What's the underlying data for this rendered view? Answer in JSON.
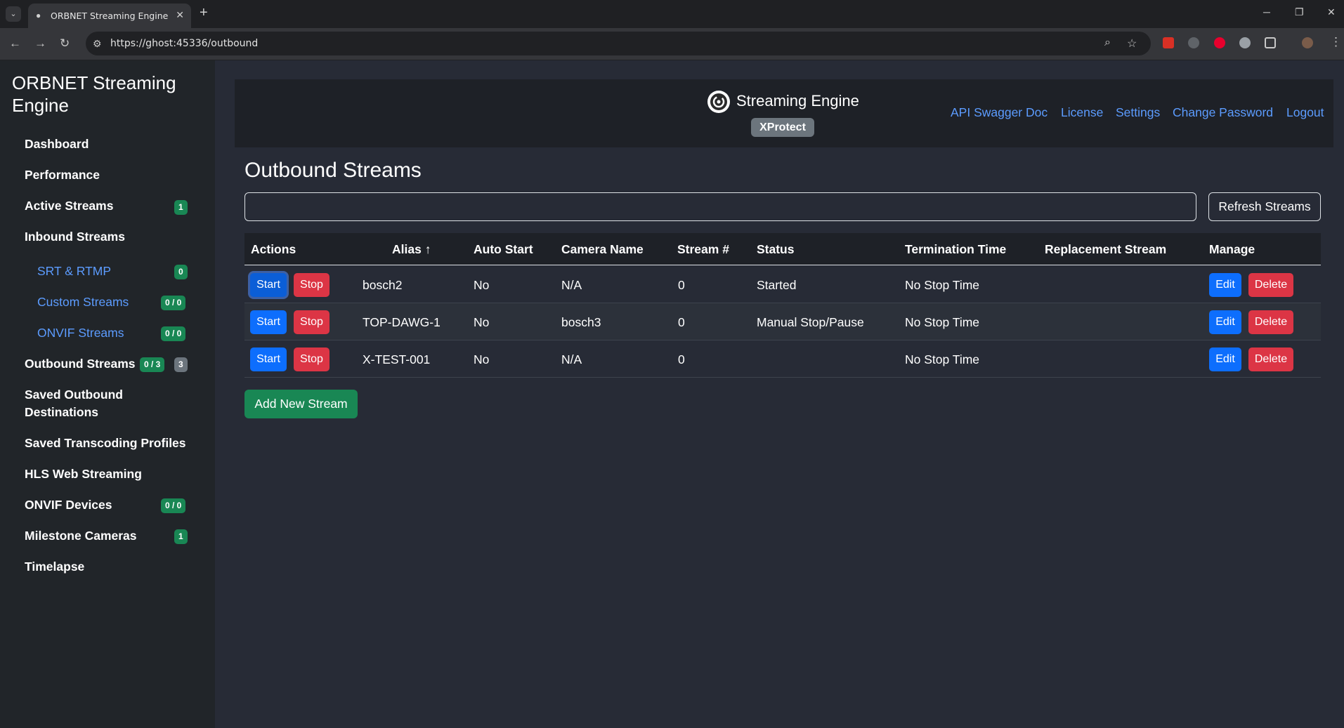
{
  "browser": {
    "tab_title": "ORBNET Streaming Engine",
    "url": "https://ghost:45336/outbound"
  },
  "sidebar": {
    "brand": "ORBNET Streaming Engine",
    "items": [
      {
        "label": "Dashboard"
      },
      {
        "label": "Performance"
      },
      {
        "label": "Active Streams",
        "badge": "1"
      },
      {
        "label": "Inbound Streams"
      },
      {
        "label": "SRT & RTMP",
        "badge": "0"
      },
      {
        "label": "Custom Streams",
        "badge": "0 / 0"
      },
      {
        "label": "ONVIF Streams",
        "badge": "0 / 0"
      },
      {
        "label": "Outbound Streams",
        "badge": "0 / 3",
        "badge2": "3"
      },
      {
        "label": "Saved Outbound Destinations"
      },
      {
        "label": "Saved Transcoding Profiles"
      },
      {
        "label": "HLS Web Streaming"
      },
      {
        "label": "ONVIF Devices",
        "badge": "0 / 0"
      },
      {
        "label": "Milestone Cameras",
        "badge": "1"
      },
      {
        "label": "Timelapse"
      }
    ]
  },
  "header": {
    "app_title": "Streaming Engine",
    "edition": "XProtect",
    "links": [
      "API Swagger Doc",
      "License",
      "Settings",
      "Change Password",
      "Logout"
    ]
  },
  "main": {
    "title": "Outbound Streams",
    "filter_value": "",
    "refresh_label": "Refresh Streams",
    "add_label": "Add New Stream",
    "columns": [
      "Actions",
      "Alias ↑",
      "Auto Start",
      "Camera Name",
      "Stream #",
      "Status",
      "Termination Time",
      "Replacement Stream",
      "Manage"
    ],
    "buttons": {
      "start": "Start",
      "stop": "Stop",
      "edit": "Edit",
      "delete": "Delete"
    },
    "rows": [
      {
        "alias": "bosch2",
        "auto_start": "No",
        "camera": "N/A",
        "stream": "0",
        "status": "Started",
        "termination": "No Stop Time",
        "replacement": ""
      },
      {
        "alias": "TOP-DAWG-1",
        "auto_start": "No",
        "camera": "bosch3",
        "stream": "0",
        "status": "Manual Stop/Pause",
        "termination": "No Stop Time",
        "replacement": ""
      },
      {
        "alias": "X-TEST-001",
        "auto_start": "No",
        "camera": "N/A",
        "stream": "0",
        "status": "",
        "termination": "No Stop Time",
        "replacement": ""
      }
    ]
  },
  "colors": {
    "accent_blue": "#0d6efd",
    "danger_red": "#dc3545",
    "success_green": "#198754",
    "link_blue": "#5c9cff"
  }
}
